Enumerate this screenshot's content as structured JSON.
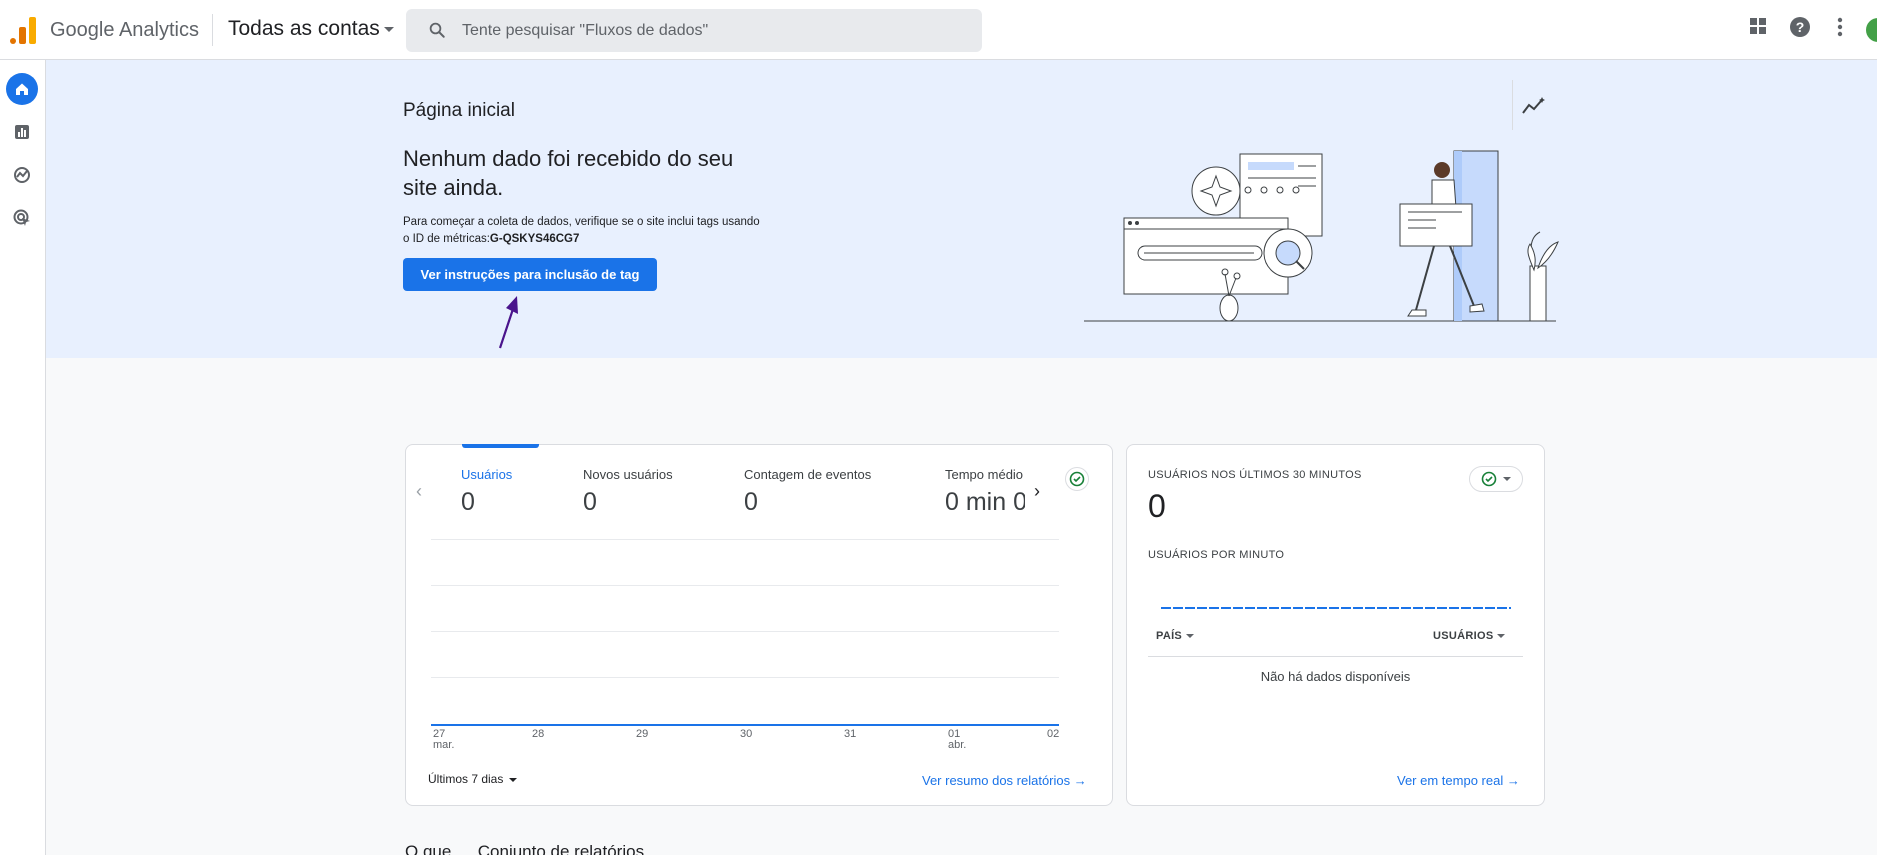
{
  "header": {
    "app_name": "Google Analytics",
    "account_selector": "Todas as contas",
    "search_placeholder": "Tente pesquisar \"Fluxos de dados\""
  },
  "hero": {
    "page_title": "Página inicial",
    "headline": "Nenhum dado foi recebido do seu site ainda.",
    "subtext": "Para começar a coleta de dados, verifique se o site inclui tags usando o ID de métricas:",
    "measurement_id": "G-QSKYS46CG7",
    "cta_label": "Ver instruções para inclusão de tag"
  },
  "metrics_card": {
    "metrics": [
      {
        "label": "Usuários",
        "value": "0"
      },
      {
        "label": "Novos usuários",
        "value": "0"
      },
      {
        "label": "Contagem de eventos",
        "value": "0"
      },
      {
        "label": "Tempo médio",
        "value": "0 min 0"
      }
    ],
    "x_ticks": [
      {
        "day": "27",
        "month": "mar."
      },
      {
        "day": "28",
        "month": ""
      },
      {
        "day": "29",
        "month": ""
      },
      {
        "day": "30",
        "month": ""
      },
      {
        "day": "31",
        "month": ""
      },
      {
        "day": "01",
        "month": "abr."
      },
      {
        "day": "02",
        "month": ""
      }
    ],
    "date_range": "Últimos 7 dias",
    "link_label": "Ver resumo dos relatórios"
  },
  "realtime_card": {
    "title": "USUÁRIOS NOS ÚLTIMOS 30 MINUTOS",
    "value": "0",
    "per_minute_label": "USUÁRIOS POR MINUTO",
    "col_country": "PAÍS",
    "col_users": "USUÁRIOS",
    "no_data": "Não há dados disponíveis",
    "link_label": "Ver em tempo real"
  },
  "bottom": {
    "partial_text": "O que … Conjunto de relatórios"
  },
  "colors": {
    "accent": "#1a73e8",
    "hero_bg": "#e8f0fe",
    "ga_orange": "#e37400",
    "ga_yellow": "#f9ab00",
    "annotation_arrow": "#4a148c"
  }
}
